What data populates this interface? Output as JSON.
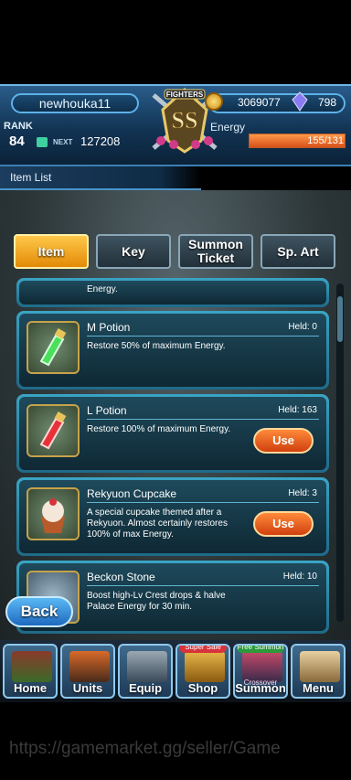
{
  "player": {
    "name": "newhouka11",
    "rank_label": "RANK",
    "rank": "84",
    "next_label": "NEXT",
    "next_exp": "127208",
    "coins": "3069077",
    "gems": "798",
    "energy_label": "Energy",
    "energy": "155/131",
    "energy_fraction": 1.0
  },
  "logo": {
    "text": "SS",
    "sub": "FIGHTERS"
  },
  "screen": {
    "title": "Item List"
  },
  "tabs": [
    {
      "label": "Item",
      "active": true
    },
    {
      "label": "Key",
      "active": false
    },
    {
      "label": "Summon Ticket",
      "active": false
    },
    {
      "label": "Sp. Art",
      "active": false
    }
  ],
  "items": [
    {
      "name": "M Potion",
      "held": "Held: 0",
      "desc": "Restore 50% of maximum Energy.",
      "use": ""
    },
    {
      "name": "L Potion",
      "held": "Held: 163",
      "desc": "Restore 100% of maximum Energy.",
      "use": "Use"
    },
    {
      "name": "Rekyuon Cupcake",
      "held": "Held: 3",
      "desc": "A special cupcake themed after a Rekyuon. Almost certainly restores 100% of max Energy.",
      "use": "Use"
    },
    {
      "name": "Beckon Stone",
      "held": "Held: 10",
      "desc": "Boost high-Lv Crest drops & halve Palace Energy for 30 min.",
      "use": ""
    }
  ],
  "partial_item_desc": "Energy.",
  "back_label": "Back",
  "nav": [
    {
      "label": "Home",
      "badge": ""
    },
    {
      "label": "Units",
      "badge": ""
    },
    {
      "label": "Equip",
      "badge": ""
    },
    {
      "label": "Shop",
      "badge": "Super Sale"
    },
    {
      "label": "Summon",
      "badge": "Free Summon",
      "sub": "Crossover"
    },
    {
      "label": "Menu",
      "badge": ""
    }
  ],
  "watermark": "https://gamemarket.gg/seller/Game",
  "colors": {
    "accent": "#e38a06",
    "energy": "#d8501a",
    "frame": "#3aa4c4"
  }
}
